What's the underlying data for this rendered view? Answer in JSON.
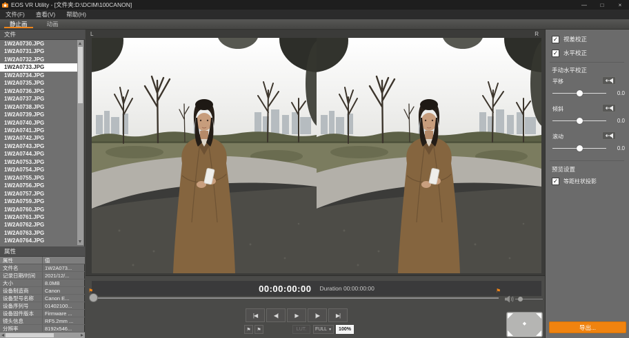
{
  "window": {
    "title": "EOS VR Utility - [文件夹:D:\\DCIM\\100CANON]",
    "controls": {
      "minimize": "—",
      "maximize": "□",
      "close": "×"
    }
  },
  "menu_bar": {
    "items": [
      "文件(F)",
      "查看(V)",
      "帮助(H)"
    ]
  },
  "tab_bar": {
    "tabs": [
      {
        "label": "静止画",
        "active": true
      },
      {
        "label": "动画",
        "active": false
      }
    ]
  },
  "file_panel": {
    "header": "文件",
    "selected_file": "1W2A0733.JPG",
    "files": [
      "1W2A0730.JPG",
      "1W2A0731.JPG",
      "1W2A0732.JPG",
      "1W2A0733.JPG",
      "1W2A0734.JPG",
      "1W2A0735.JPG",
      "1W2A0736.JPG",
      "1W2A0737.JPG",
      "1W2A0738.JPG",
      "1W2A0739.JPG",
      "1W2A0740.JPG",
      "1W2A0741.JPG",
      "1W2A0742.JPG",
      "1W2A0743.JPG",
      "1W2A0744.JPG",
      "1W2A0753.JPG",
      "1W2A0754.JPG",
      "1W2A0755.JPG",
      "1W2A0756.JPG",
      "1W2A0757.JPG",
      "1W2A0759.JPG",
      "1W2A0760.JPG",
      "1W2A0761.JPG",
      "1W2A0762.JPG",
      "1W2A0763.JPG",
      "1W2A0764.JPG"
    ]
  },
  "properties_panel": {
    "header": "属性",
    "columns": {
      "name": "属性",
      "value": "值"
    },
    "rows": [
      {
        "name": "文件名",
        "value": "1W2A073..."
      },
      {
        "name": "记录日期/时间",
        "value": "2021/12/..."
      },
      {
        "name": "大小",
        "value": "8.0MB"
      },
      {
        "name": "设备制造商",
        "value": "Canon"
      },
      {
        "name": "设备型号名称",
        "value": "Canon E..."
      },
      {
        "name": "设备序列号",
        "value": "01402100..."
      },
      {
        "name": "设备固件版本",
        "value": "Firmware ..."
      },
      {
        "name": "镜头信息",
        "value": "RF5.2mm ..."
      },
      {
        "name": "分辨率",
        "value": "8192x546..."
      }
    ]
  },
  "preview": {
    "left_label": "L",
    "right_label": "R"
  },
  "adjust_panel": {
    "parallax_checkbox": {
      "label": "视差校正",
      "checked": true
    },
    "horizontal_checkbox": {
      "label": "水平校正",
      "checked": true
    },
    "manual_section": {
      "header": "手动水平校正",
      "sliders": [
        {
          "label": "平移",
          "value": "0.0"
        },
        {
          "label": "倾斜",
          "value": "0.0"
        },
        {
          "label": "滚动",
          "value": "0.0"
        }
      ]
    },
    "preview_section": {
      "header": "预览设置",
      "equirect_checkbox": {
        "label": "等距柱状投影",
        "checked": true
      }
    }
  },
  "timeline": {
    "timecode": "00:00:00:00",
    "duration_label": "Duration",
    "duration_value": "00:00:00:00"
  },
  "transport": {
    "buttons": [
      {
        "glyph": "|◀"
      },
      {
        "glyph": "◀|"
      },
      {
        "glyph": "▶"
      },
      {
        "glyph": "|▶"
      },
      {
        "glyph": "▶|"
      }
    ],
    "lut_label": "LUT.",
    "full_label": "FULL",
    "zoom_label": "100%"
  },
  "export_button": {
    "label": "导出..."
  },
  "icons": {
    "check": "✓",
    "flag": "⚑",
    "dropdown": "▼",
    "diamond": "◆"
  },
  "colors": {
    "accent": "#EF8519",
    "selection": "#FFFFFF"
  }
}
